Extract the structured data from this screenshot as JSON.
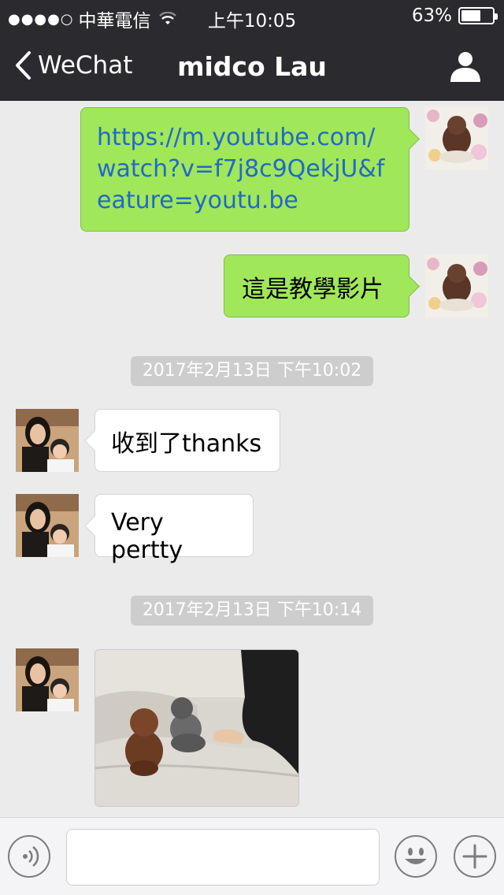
{
  "status_bar": {
    "carrier": "中華電信",
    "time": "上午10:05",
    "battery_text": "63%",
    "battery_level": 0.63
  },
  "nav": {
    "back_label": "WeChat",
    "title": "midco Lau"
  },
  "messages": {
    "link": "https://m.youtube.com/watch?v=f7j8c9QekjU&feature=youtu.be",
    "sent_text": "這是教學影片",
    "timestamp_1": "2017年2月13日 下午10:02",
    "received_1": "收到了thanks",
    "received_2": "Very pertty",
    "timestamp_2": "2017年2月13日 下午10:14"
  },
  "colors": {
    "sent_bubble": "#a0e75a",
    "link": "#2269c9",
    "nav_bg": "#2b2b2f"
  }
}
